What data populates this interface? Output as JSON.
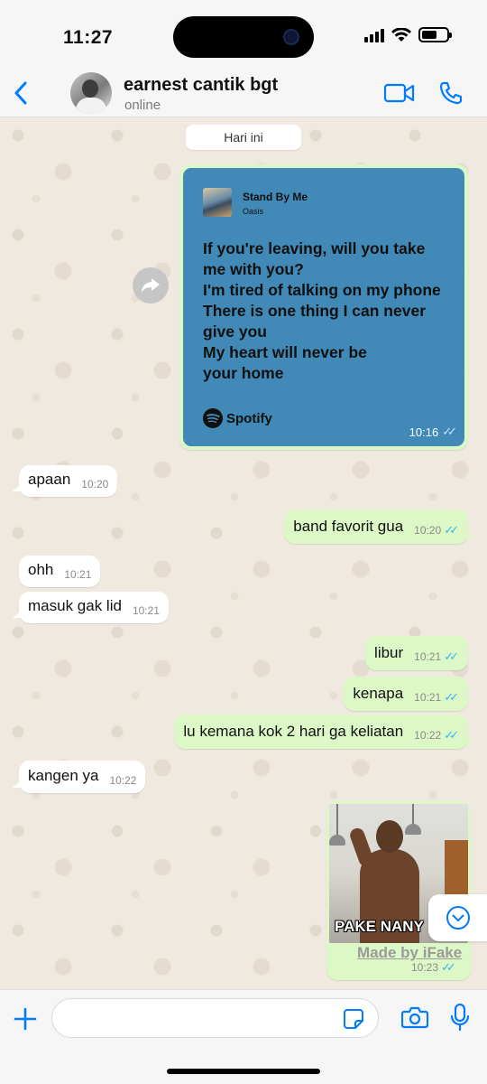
{
  "status_bar": {
    "time": "11:27",
    "battery_level": 0.6
  },
  "header": {
    "contact_name": "earnest cantik bgt",
    "contact_status": "online",
    "accent_color": "#007aff"
  },
  "date_divider": "Hari ini",
  "spotify_share": {
    "song_title": "Stand By Me",
    "artist": "Oasis",
    "lyrics": [
      "If you're leaving, will you take",
      "me with you?",
      "I'm tired of talking on my phone",
      "There is one thing I can never",
      "give you",
      "My heart will never be",
      "your home"
    ],
    "brand": "Spotify",
    "card_color": "#4189b6",
    "time": "10:16"
  },
  "messages": [
    {
      "text": "apaan",
      "time": "10:20",
      "direction": "in"
    },
    {
      "text": "band favorit gua",
      "time": "10:20",
      "direction": "out"
    },
    {
      "text": "ohh",
      "time": "10:21",
      "direction": "in"
    },
    {
      "text": "masuk gak lid",
      "time": "10:21",
      "direction": "in"
    },
    {
      "text": "libur",
      "time": "10:21",
      "direction": "out"
    },
    {
      "text": "kenapa",
      "time": "10:21",
      "direction": "out"
    },
    {
      "text": "lu kemana kok 2 hari ga keliatan",
      "time": "10:22",
      "direction": "out"
    },
    {
      "text": "kangen ya",
      "time": "10:22",
      "direction": "in"
    }
  ],
  "image_message": {
    "caption_in_image": "PAKE NANY",
    "watermark": "Made by iFake",
    "time": "10:23"
  },
  "input": {
    "placeholder": "",
    "value": ""
  },
  "colors": {
    "incoming_bubble": "#ffffff",
    "outgoing_bubble": "#dcf8c6",
    "read_ticks": "#34b7f1",
    "wallpaper": "#efe9df"
  }
}
